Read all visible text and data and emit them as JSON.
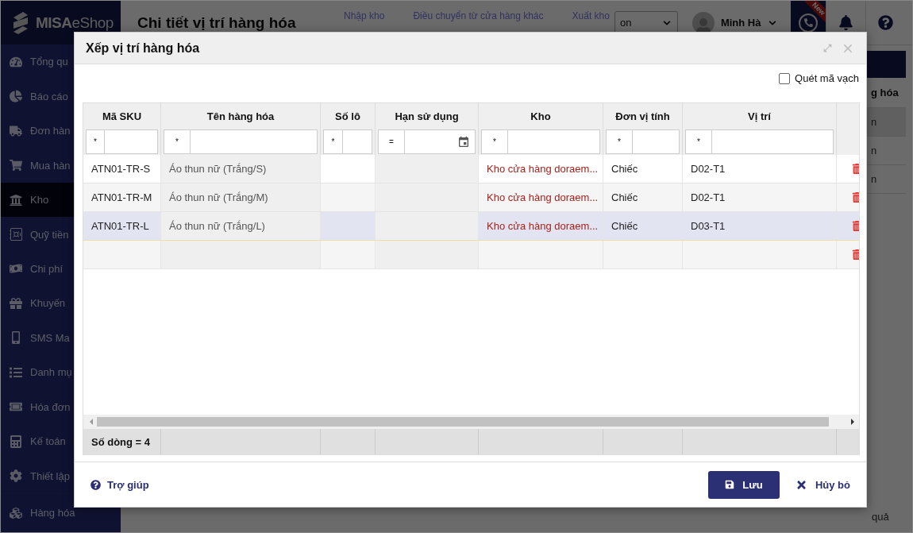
{
  "app": {
    "logo": "**MISA**eShop",
    "page_title": "Chi tiết vị trí hàng hóa",
    "nav_links": [
      "Nhập kho",
      "Điều chuyển từ cửa hàng khác",
      "Xuất kho"
    ],
    "store_select": {
      "value": "on"
    },
    "user": {
      "name": "Minh Hà"
    },
    "phone_badge": "New"
  },
  "sidebar": {
    "items": [
      {
        "label": "Tổng qu",
        "selected": false
      },
      {
        "label": "Báo cáo",
        "selected": false
      },
      {
        "label": "Đơn hàn",
        "selected": false
      },
      {
        "label": "Mua hàn",
        "selected": false
      },
      {
        "label": "Kho",
        "selected": true
      },
      {
        "label": "Quỹ tiền",
        "selected": false
      },
      {
        "label": "Chi phí",
        "selected": false
      },
      {
        "label": "Khuyến",
        "selected": false
      },
      {
        "label": "SMS Ma",
        "selected": false
      },
      {
        "label": "Danh mụ",
        "selected": false
      },
      {
        "label": "Hóa đơn",
        "selected": false
      },
      {
        "label": "Kế toán",
        "selected": false
      },
      {
        "label": "Thiết lập",
        "selected": false
      }
    ],
    "footer_item": {
      "label": "Hàng hóa"
    }
  },
  "background_table": {
    "column_header": "g hóa",
    "cells": [
      "n",
      "n",
      "n"
    ],
    "footer_text": "quả"
  },
  "dialog": {
    "title": "Xếp vị trí hàng hóa",
    "scan_barcode": {
      "label": "Quét mã vạch",
      "checked": false
    },
    "table": {
      "columns": [
        {
          "label": "Mã SKU",
          "filter_operator": "*",
          "kind": "text",
          "readonly": false
        },
        {
          "label": "Tên hàng hóa",
          "filter_operator": "*",
          "kind": "text",
          "readonly": true
        },
        {
          "label": "Số lô",
          "filter_operator": "*",
          "kind": "text",
          "readonly": false
        },
        {
          "label": "Hạn sử dụng",
          "filter_operator": "=",
          "kind": "date",
          "readonly": true
        },
        {
          "label": "Kho",
          "filter_operator": "*",
          "kind": "text",
          "readonly": false
        },
        {
          "label": "Đơn vị tính",
          "filter_operator": "*",
          "kind": "text",
          "readonly": false
        },
        {
          "label": "Vị trí",
          "filter_operator": "*",
          "kind": "text",
          "readonly": false
        }
      ],
      "rows": [
        {
          "sku": "ATN01-TR-S",
          "product_name": "Áo thun nữ (Trắng/S)",
          "warehouse": "Kho cửa hàng doraem...",
          "unit": "Chiếc",
          "location": "D02-T1",
          "selected": false
        },
        {
          "sku": "ATN01-TR-M",
          "product_name": "Áo thun nữ (Trắng/M)",
          "warehouse": "Kho cửa hàng doraem...",
          "unit": "Chiếc",
          "location": "D02-T1",
          "selected": false
        },
        {
          "sku": "ATN01-TR-L",
          "product_name": "Áo thun nữ (Trắng/L)",
          "warehouse": "Kho cửa hàng doraem...",
          "unit": "Chiếc",
          "location": "D03-T1",
          "selected": true
        },
        {
          "selected": false
        }
      ],
      "row_count": "Số dòng = 4"
    },
    "buttons": {
      "help": "Trợ giúp",
      "save": "Lưu",
      "cancel": "Hủy bỏ"
    }
  }
}
